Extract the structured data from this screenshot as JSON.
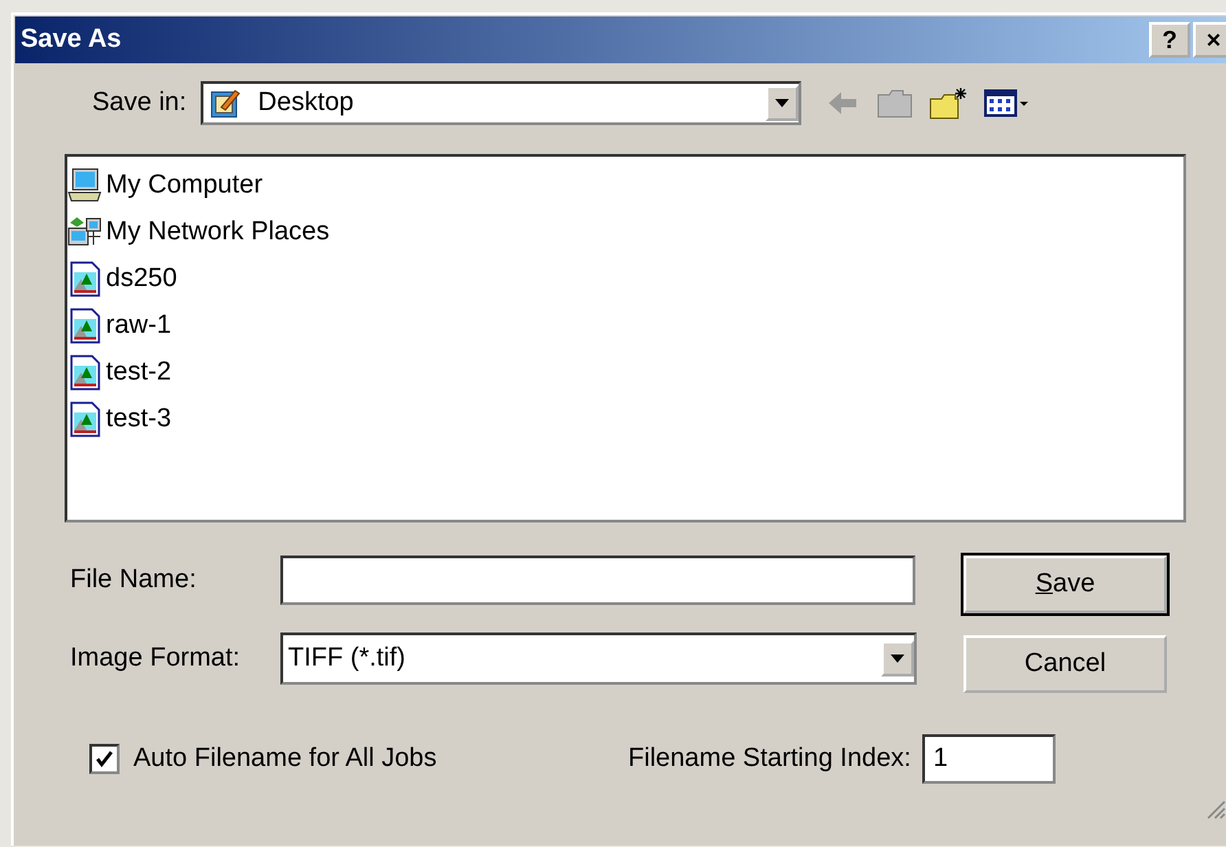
{
  "window": {
    "title": "Save As",
    "title_buttons": [
      "?",
      "×"
    ]
  },
  "save_in": {
    "label": "Save in:",
    "value": "Desktop"
  },
  "files": [
    {
      "name": "My Computer",
      "kind": "computer"
    },
    {
      "name": "My Network Places",
      "kind": "network"
    },
    {
      "name": "ds250",
      "kind": "image"
    },
    {
      "name": "raw-1",
      "kind": "image"
    },
    {
      "name": "test-2",
      "kind": "image"
    },
    {
      "name": "test-3",
      "kind": "image"
    }
  ],
  "file_name": {
    "label": "File Name:"
  },
  "image_format": {
    "label": "Image Format:",
    "value": "TIFF (*.tif)"
  },
  "buttons": [
    {
      "label": "Save",
      "default": true
    },
    {
      "label": "Cancel",
      "default": false
    }
  ],
  "auto_filename": {
    "label": "Auto Filename for All Jobs",
    "checked": true
  },
  "start_index": {
    "label": "Filename Starting Index:",
    "value": "1"
  }
}
